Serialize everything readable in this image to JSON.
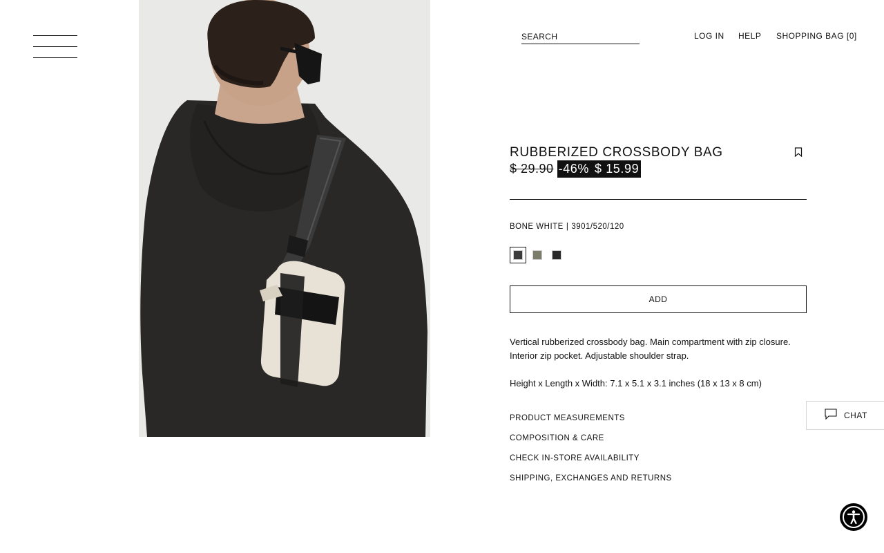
{
  "header": {
    "menu_icon": "hamburger-menu-icon",
    "search_placeholder": "SEARCH",
    "login_label": "LOG IN",
    "help_label": "HELP",
    "bag_label": "SHOPPING BAG [0]"
  },
  "product": {
    "title": "RUBBERIZED CROSSBODY BAG",
    "old_price": "$ 29.90",
    "discount": "-46%",
    "sale_price": "$ 15.99",
    "color_name": "BONE WHITE",
    "separator": "|",
    "reference": "3901/520/120",
    "swatches": [
      {
        "color": "#3b3b3b",
        "selected": true
      },
      {
        "color": "#7b7c69",
        "selected": false
      },
      {
        "color": "#2a2a2a",
        "selected": false
      }
    ],
    "add_label": "ADD",
    "description": "Vertical rubberized crossbody bag. Main compartment with zip closure. Interior zip pocket. Adjustable shoulder strap.",
    "dimensions": "Height x Length x Width: 7.1 x 5.1 x 3.1 inches (18 x 13 x 8 cm)"
  },
  "accordion": {
    "measurements": "PRODUCT MEASUREMENTS",
    "composition": "COMPOSITION & CARE",
    "availability": "CHECK IN-STORE AVAILABILITY",
    "shipping": "SHIPPING, EXCHANGES AND RETURNS"
  },
  "chat": {
    "label": "CHAT",
    "icon": "chat-bubble-icon"
  },
  "accessibility": {
    "icon": "accessibility-icon"
  },
  "colors": {
    "text": "#111111",
    "sale_bg": "#111111",
    "sale_text": "#ffffff",
    "photo_bg": "#e9e9e7",
    "hoodie": "#2a2827",
    "bag": "#e8e2d6"
  }
}
